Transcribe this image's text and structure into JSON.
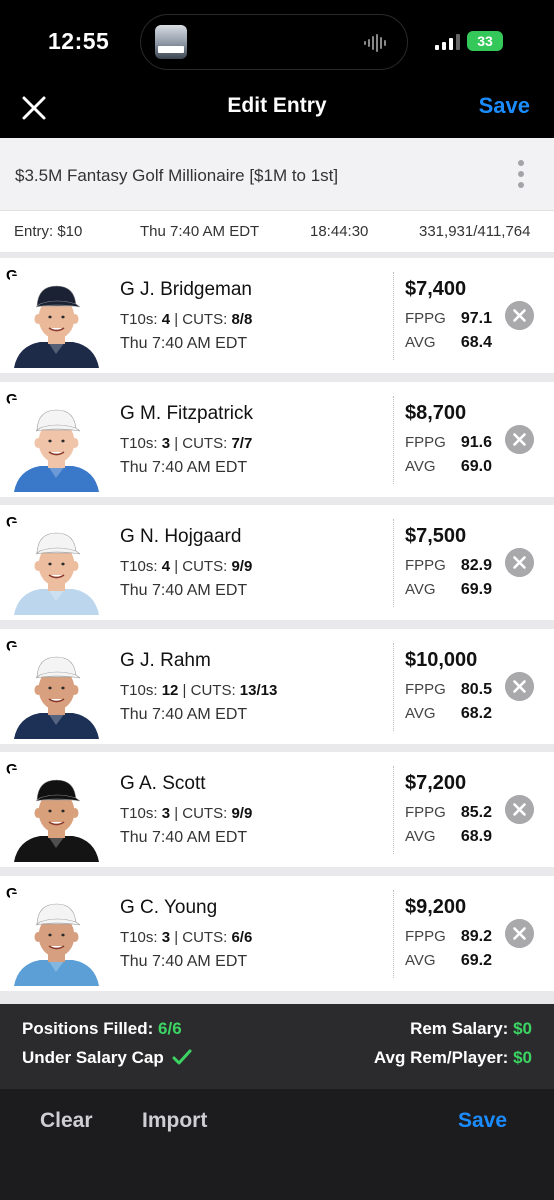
{
  "status": {
    "time": "12:55",
    "battery": "33"
  },
  "header": {
    "title": "Edit Entry",
    "save_label": "Save"
  },
  "contest": {
    "name": "$3.5M Fantasy Golf Millionaire [$1M to 1st]"
  },
  "entry_info": {
    "fee": "Entry: $10",
    "start": "Thu 7:40 AM EDT",
    "countdown": "18:44:30",
    "entries": "331,931/411,764"
  },
  "players": [
    {
      "pos": "G",
      "name": "G  J. Bridgeman",
      "t10s_label": "T10s:",
      "t10s": "4",
      "cuts_label": "| CUTS:",
      "cuts": "8/8",
      "time": "Thu 7:40 AM EDT",
      "salary": "$7,400",
      "fppg_label": "FPPG",
      "fppg": "97.1",
      "avg_label": "AVG",
      "avg": "68.4",
      "shirt": "#1d2b49",
      "cap": "#1b2233",
      "skin": "#e9b99a",
      "hair": "#6b4a2b"
    },
    {
      "pos": "G",
      "name": "G  M. Fitzpatrick",
      "t10s_label": "T10s:",
      "t10s": "3",
      "cuts_label": "| CUTS:",
      "cuts": "7/7",
      "time": "Thu 7:40 AM EDT",
      "salary": "$8,700",
      "fppg_label": "FPPG",
      "fppg": "91.6",
      "avg_label": "AVG",
      "avg": "69.0",
      "shirt": "#3a78c9",
      "cap": "#f4f4f4",
      "skin": "#f0c4a8",
      "hair": "#8a6a4a"
    },
    {
      "pos": "G",
      "name": "G  N. Hojgaard",
      "t10s_label": "T10s:",
      "t10s": "4",
      "cuts_label": "| CUTS:",
      "cuts": "9/9",
      "time": "Thu 7:40 AM EDT",
      "salary": "$7,500",
      "fppg_label": "FPPG",
      "fppg": "82.9",
      "avg_label": "AVG",
      "avg": "69.9",
      "shirt": "#bcd6ee",
      "cap": "#f4f4f4",
      "skin": "#ecbd9e",
      "hair": "#9b7a55"
    },
    {
      "pos": "G",
      "name": "G  J. Rahm",
      "t10s_label": "T10s:",
      "t10s": "12",
      "cuts_label": "| CUTS:",
      "cuts": "13/13",
      "time": "Thu 7:40 AM EDT",
      "salary": "$10,000",
      "fppg_label": "FPPG",
      "fppg": "80.5",
      "avg_label": "AVG",
      "avg": "68.2",
      "shirt": "#1d3157",
      "cap": "#f4f4f4",
      "skin": "#d8a07e",
      "hair": "#3e2a1c"
    },
    {
      "pos": "G",
      "name": "G  A. Scott",
      "t10s_label": "T10s:",
      "t10s": "3",
      "cuts_label": "| CUTS:",
      "cuts": "9/9",
      "time": "Thu 7:40 AM EDT",
      "salary": "$7,200",
      "fppg_label": "FPPG",
      "fppg": "85.2",
      "avg_label": "AVG",
      "avg": "68.9",
      "shirt": "#141414",
      "cap": "#111111",
      "skin": "#d9a07c",
      "hair": "#2f2114"
    },
    {
      "pos": "G",
      "name": "G  C. Young",
      "t10s_label": "T10s:",
      "t10s": "3",
      "cuts_label": "| CUTS:",
      "cuts": "6/6",
      "time": "Thu 7:40 AM EDT",
      "salary": "$9,200",
      "fppg_label": "FPPG",
      "fppg": "89.2",
      "avg_label": "AVG",
      "avg": "69.2",
      "shirt": "#5b9fd6",
      "cap": "#f4f4f4",
      "skin": "#d6a080",
      "hair": "#4a3322"
    }
  ],
  "summary": {
    "positions_label": "Positions Filled:",
    "positions_value": "6/6",
    "cap_label": "Under Salary Cap",
    "rem_salary_label": "Rem Salary:",
    "rem_salary_value": "$0",
    "avg_rem_label": "Avg Rem/Player:",
    "avg_rem_value": "$0"
  },
  "bottom": {
    "clear_label": "Clear",
    "import_label": "Import",
    "save_label": "Save"
  },
  "colors": {
    "accent": "#1a8cff",
    "positive": "#3bd463"
  }
}
